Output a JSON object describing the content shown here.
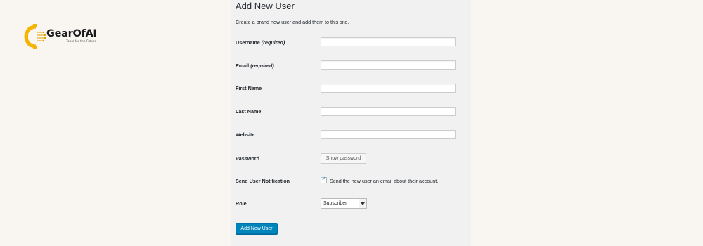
{
  "brand": {
    "name": "GearOfAI",
    "tagline": "Tools for the Future",
    "colors": {
      "gear": "#f4b400",
      "text": "#1a1a1a"
    }
  },
  "page": {
    "title": "Add New User",
    "description": "Create a brand new user and add them to this site."
  },
  "form": {
    "username": {
      "label": "Username",
      "note": "(required)",
      "value": ""
    },
    "email": {
      "label": "Email",
      "note": "(required)",
      "value": ""
    },
    "first_name": {
      "label": "First Name",
      "value": ""
    },
    "last_name": {
      "label": "Last Name",
      "value": ""
    },
    "website": {
      "label": "Website",
      "value": ""
    },
    "password": {
      "label": "Password",
      "button_label": "Show password"
    },
    "notification": {
      "label": "Send User Notification",
      "checkbox_label": "Send the new user an email about their account.",
      "checked": true
    },
    "role": {
      "label": "Role",
      "selected": "Subscriber"
    },
    "submit_label": "Add New User"
  },
  "colors": {
    "primary_button": "#0085ba",
    "panel_bg": "#f1f1f1",
    "page_bg": "#f9f6f2"
  }
}
